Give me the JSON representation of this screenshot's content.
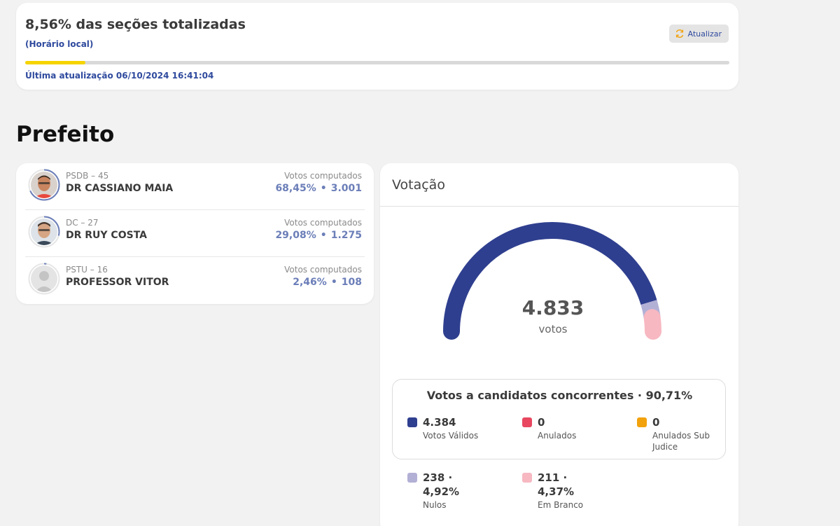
{
  "status": {
    "title": "8,56% das seções totalizadas",
    "subtitle": "(Horário local)",
    "refresh_label": "Atualizar",
    "progress": 0.0856,
    "updated": "Última atualização 06/10/2024 16:41:04"
  },
  "section": {
    "title": "Prefeito"
  },
  "candidates": [
    {
      "party": "PSDB – 45",
      "name": "DR CASSIANO MAIA",
      "votes_label": "Votos computados",
      "percent": "68,45%",
      "separator": "•",
      "votes": "3.001"
    },
    {
      "party": "DC – 27",
      "name": "DR RUY COSTA",
      "votes_label": "Votos computados",
      "percent": "29,08%",
      "separator": "•",
      "votes": "1.275"
    },
    {
      "party": "PSTU – 16",
      "name": "PROFESSOR VITOR",
      "votes_label": "Votos computados",
      "percent": "2,46%",
      "separator": "•",
      "votes": "108"
    }
  ],
  "votacao": {
    "title": "Votação",
    "total": "4.833",
    "total_unit": "votos",
    "gauge_segments": [
      {
        "name": "valid",
        "value": 4384,
        "color": "#2f3f8f"
      },
      {
        "name": "null",
        "value": 238,
        "color": "#b3b0d6"
      },
      {
        "name": "blank",
        "value": 211,
        "color": "#f7b8c1"
      }
    ],
    "valid_box": {
      "title": "Votos a candidatos concorrentes · 90,71%",
      "items": [
        {
          "value": "4.384",
          "label": "Votos Válidos",
          "color": "#2f3f8f"
        },
        {
          "value": "0",
          "label": "Anulados",
          "color": "#e8475f"
        },
        {
          "value": "0",
          "label": "Anulados Sub Judice",
          "color": "#f2a20c"
        }
      ]
    },
    "other": [
      {
        "value": "238 · 4,92%",
        "label": "Nulos",
        "color": "#b3b0d6"
      },
      {
        "value": "211 · 4,37%",
        "label": "Em Branco",
        "color": "#f7b8c1"
      }
    ]
  }
}
